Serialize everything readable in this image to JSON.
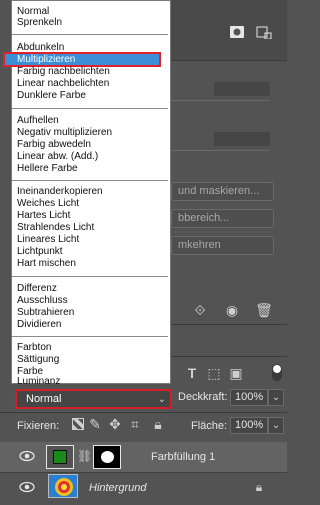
{
  "blend_modes": {
    "groups": [
      [
        "Normal",
        "Sprenkeln"
      ],
      [
        "Abdunkeln",
        "Multiplizieren",
        "Farbig nachbelichten",
        "Linear nachbelichten",
        "Dunklere Farbe"
      ],
      [
        "Aufhellen",
        "Negativ multiplizieren",
        "Farbig abwedeln",
        "Linear abw. (Add.)",
        "Hellere Farbe"
      ],
      [
        "Ineinanderkopieren",
        "Weiches Licht",
        "Hartes Licht",
        "Strahlendes Licht",
        "Lineares Licht",
        "Lichtpunkt",
        "Hart mischen"
      ],
      [
        "Differenz",
        "Ausschluss",
        "Subtrahieren",
        "Dividieren"
      ],
      [
        "Farbton",
        "Sättigung",
        "Farbe",
        "Luminanz"
      ]
    ],
    "highlighted": "Multiplizieren",
    "highlight_color": "#3a8fd6"
  },
  "background_panel": {
    "button_1": "und maskieren...",
    "button_2": "bbereich...",
    "button_3": "mkehren"
  },
  "layers": {
    "blend_select": "Normal",
    "opacity_label": "Deckkraft:",
    "opacity_value": "100%",
    "lock_label": "Fixieren:",
    "fill_label": "Fläche:",
    "fill_value": "100%",
    "items": [
      {
        "name": "Farbfüllung 1",
        "swatch_color": "#1a8a1a"
      },
      {
        "name": "Hintergrund"
      }
    ]
  },
  "colors": {
    "selection_border": "#d41f2a",
    "panel_bg": "#535353"
  }
}
